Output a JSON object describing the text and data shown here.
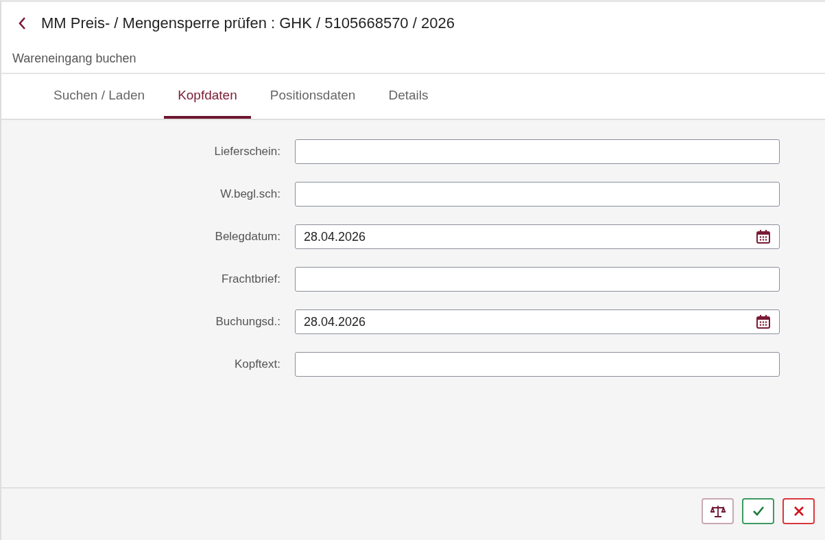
{
  "header": {
    "title": "MM Preis- / Mengensperre prüfen : GHK / 5105668570 / 2026",
    "subtitle": "Wareneingang buchen"
  },
  "tabs": [
    {
      "label": "Suchen / Laden",
      "selected": false
    },
    {
      "label": "Kopfdaten",
      "selected": true
    },
    {
      "label": "Positionsdaten",
      "selected": false
    },
    {
      "label": "Details",
      "selected": false
    }
  ],
  "fields": [
    {
      "label": "Lieferschein:",
      "kind": "text"
    },
    {
      "label": "W.begl.sch:",
      "kind": "text"
    },
    {
      "label": "Belegdatum:",
      "kind": "date",
      "value": "28.04.2026"
    },
    {
      "label": "Frachtbrief:",
      "kind": "text"
    },
    {
      "label": "Buchungsd.:",
      "kind": "date",
      "value": "28.04.2026"
    },
    {
      "label": "Kopftext:",
      "kind": "text"
    }
  ],
  "footer_buttons": [
    {
      "kind": "balance"
    },
    {
      "kind": "confirm"
    },
    {
      "kind": "cancel"
    }
  ]
}
